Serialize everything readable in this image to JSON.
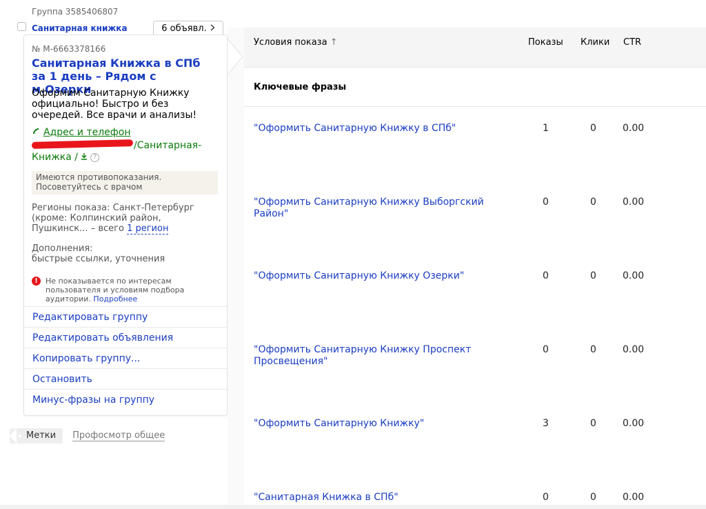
{
  "group": {
    "id_label": "Группа 3585406807",
    "name": "Санитарная книжка",
    "ads_count_label": "6 объявл.",
    "ads_count_chevron": "chevron-right-icon"
  },
  "ad": {
    "number": "№ M-6663378166",
    "title": "Санитарная Книжка в СПб за 1 день – Рядом с м.Озерки",
    "text": "Оформим Санитарную Книжку официально! Быстро и без очередей. Все врачи и анализы!",
    "contact_label": "Адрес и телефон",
    "url_path": "/Санитарная-Книжка /",
    "warning": "Имеются противопоказания. Посоветуйтесь с врачом",
    "regions_prefix": "Регионы показа: Санкт-Петербург (кроме: Колпинский район, Пушкинск... – всего",
    "regions_link": "1 регион",
    "extras_title": "Дополнения:",
    "extras_value": "быстрые ссылки, уточнения",
    "notice_text": "Не показывается по интересам пользователя и условиям подбора аудитории.",
    "notice_more": "Подробнее"
  },
  "actions": [
    "Редактировать группу",
    "Редактировать объявления",
    "Копировать группу...",
    "Остановить",
    "Минус-фразы на группу"
  ],
  "labels": {
    "tag": "Метки",
    "link": "Профосмотр общее"
  },
  "table": {
    "headers": {
      "conditions": "Условия показа",
      "sort_arrow": "↑",
      "impressions": "Показы",
      "clicks": "Клики",
      "ctr": "CTR"
    },
    "section_title": "Ключевые фразы",
    "rows": [
      {
        "phrase": "\"Оформить Санитарную Книжку в СПб\"",
        "impressions": "1",
        "clicks": "0",
        "ctr": "0.00"
      },
      {
        "phrase": "\"Оформить Санитарную Книжку Выборгский Район\"",
        "impressions": "0",
        "clicks": "0",
        "ctr": "0.00"
      },
      {
        "phrase": "\"Оформить Санитарную Книжку Озерки\"",
        "impressions": "0",
        "clicks": "0",
        "ctr": "0.00"
      },
      {
        "phrase": "\"Оформить Санитарную Книжку Проспект Просвещения\"",
        "impressions": "0",
        "clicks": "0",
        "ctr": "0.00"
      },
      {
        "phrase": "\"Оформить Санитарную Книжку\"",
        "impressions": "3",
        "clicks": "0",
        "ctr": "0.00"
      },
      {
        "phrase": "\"Санитарная Книжка в СПб\"",
        "impressions": "0",
        "clicks": "0",
        "ctr": "0.00"
      }
    ]
  },
  "colors": {
    "link_blue": "#1a3dc1",
    "url_green": "#0b7a0b",
    "alert_red": "#e8161b"
  }
}
